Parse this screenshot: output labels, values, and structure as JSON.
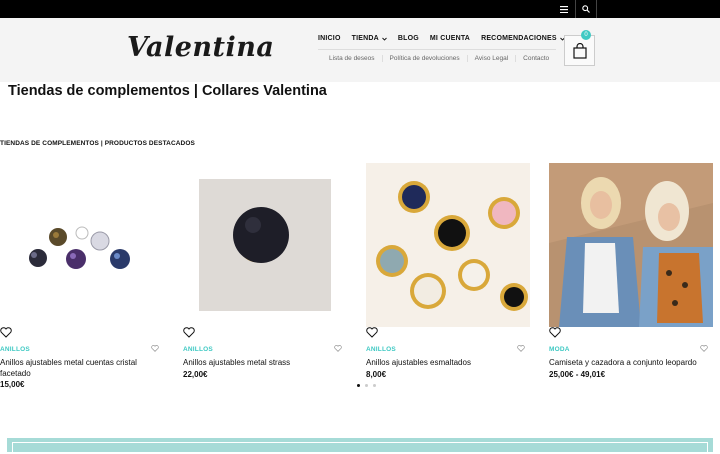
{
  "topbar": {
    "menu_icon": "menu-icon",
    "search_icon": "search-icon"
  },
  "header": {
    "logo": "Valentina",
    "nav_main": [
      {
        "label": "INICIO",
        "has_dropdown": false
      },
      {
        "label": "TIENDA",
        "has_dropdown": true
      },
      {
        "label": "BLOG",
        "has_dropdown": false
      },
      {
        "label": "MI CUENTA",
        "has_dropdown": false
      },
      {
        "label": "RECOMENDACIONES",
        "has_dropdown": true
      }
    ],
    "nav_sub": [
      "Lista de deseos",
      "Política de devoluciones",
      "Aviso Legal",
      "Contacto"
    ],
    "cart_count": "0",
    "accent_color": "#3fc9c3"
  },
  "page_title": "Tiendas de complementos | Collares Valentina",
  "section_label": "TIENDAS DE COMPLEMENTOS | PRODUCTOS DESTACADOS",
  "products": [
    {
      "category": "ANILLOS",
      "name": "Anillos ajustables metal cuentas cristal facetado",
      "price": "15,00€"
    },
    {
      "category": "ANILLOS",
      "name": "Anillos ajustables metal strass",
      "price": "22,00€"
    },
    {
      "category": "ANILLOS",
      "name": "Anillos ajustables esmaltados",
      "price": "8,00€"
    },
    {
      "category": "MODA",
      "name": "Camiseta y cazadora a conjunto leopardo",
      "price": "25,00€ - 49,01€"
    }
  ],
  "carousel": {
    "pages": 3,
    "active": 1
  }
}
